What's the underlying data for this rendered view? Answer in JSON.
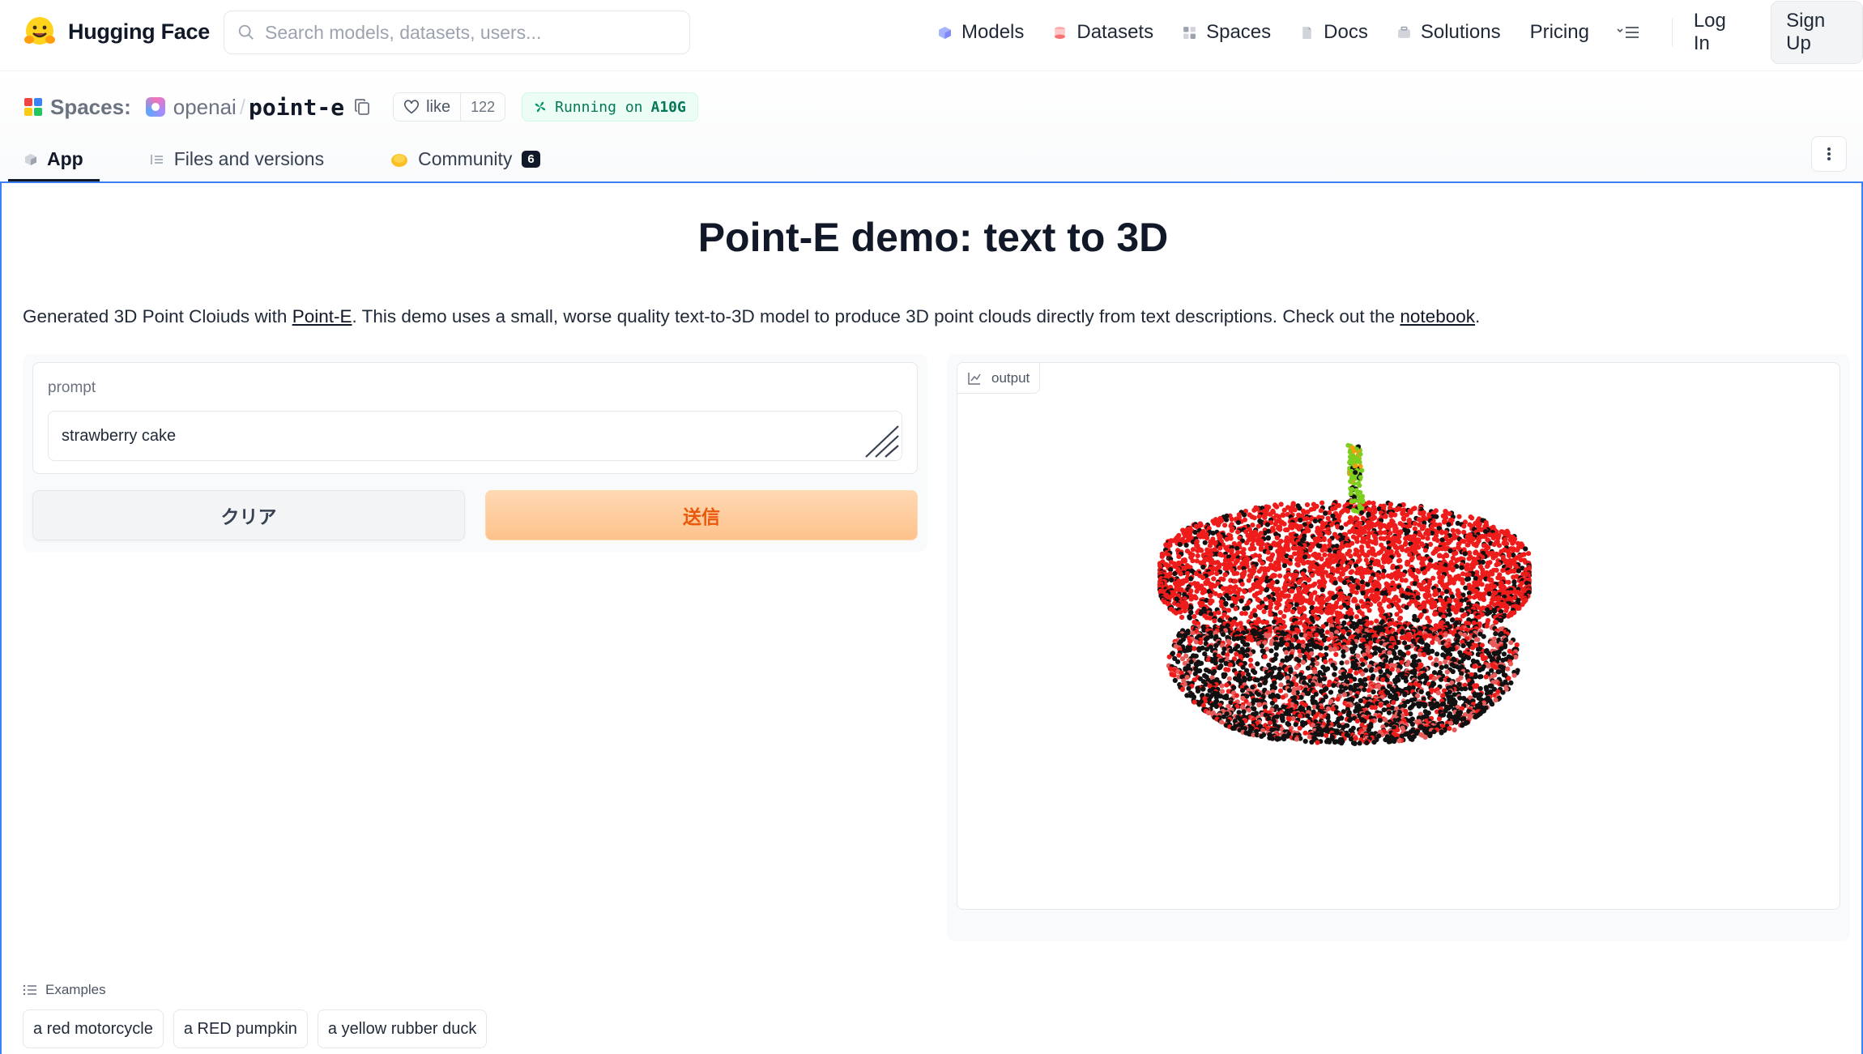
{
  "nav": {
    "brand": "Hugging Face",
    "search_placeholder": "Search models, datasets, users...",
    "links": [
      {
        "label": "Models",
        "icon": "models-icon"
      },
      {
        "label": "Datasets",
        "icon": "datasets-icon"
      },
      {
        "label": "Spaces",
        "icon": "spaces-icon"
      },
      {
        "label": "Docs",
        "icon": "docs-icon"
      },
      {
        "label": "Solutions",
        "icon": "solutions-icon"
      }
    ],
    "pricing": "Pricing",
    "login": "Log In",
    "signup": "Sign Up"
  },
  "space": {
    "label": "Spaces:",
    "org": "openai",
    "separator": "/",
    "repo": "point-e",
    "like_label": "like",
    "like_count": "122",
    "status_prefix": "Running on",
    "hardware": "A10G"
  },
  "tabs": [
    {
      "label": "App",
      "active": true
    },
    {
      "label": "Files and versions",
      "active": false
    },
    {
      "label": "Community",
      "active": false,
      "badge": "6"
    }
  ],
  "app": {
    "title": "Point-E demo: text to 3D",
    "desc_prefix": "Generated 3D Point Cloiuds with ",
    "desc_link1": "Point-E",
    "desc_middle": ". This demo uses a small, worse quality text-to-3D model to produce 3D point clouds directly from text descriptions. Check out the ",
    "desc_link2": "notebook",
    "desc_suffix": ".",
    "prompt_label": "prompt",
    "prompt_value": "strawberry cake",
    "clear_label": "クリア",
    "submit_label": "送信",
    "output_label": "output",
    "examples_label": "Examples",
    "examples": [
      "a red motorcycle",
      "a RED pumpkin",
      "a yellow rubber duck"
    ]
  },
  "colors": {
    "accent_blue": "#3b82f6",
    "submit_text": "#ea580c",
    "cloud_red": "#ef1c1c",
    "cloud_black": "#111111",
    "stem_green": "#7ccf1e"
  }
}
